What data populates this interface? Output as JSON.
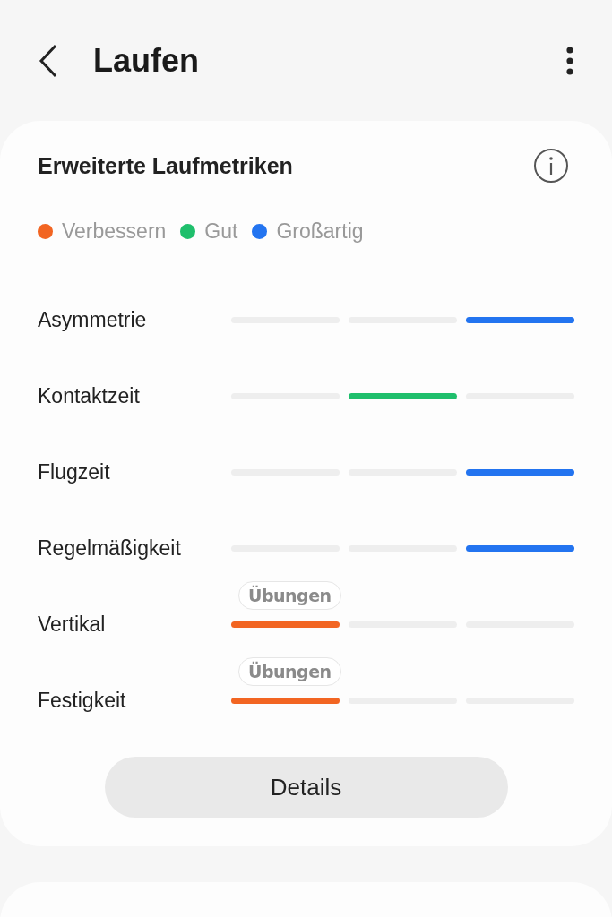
{
  "header": {
    "title": "Laufen"
  },
  "card": {
    "title": "Erweiterte Laufmetriken",
    "legend": [
      {
        "label": "Verbessern",
        "color": "#f26522"
      },
      {
        "label": "Gut",
        "color": "#1fbf6c"
      },
      {
        "label": "Großartig",
        "color": "#2374f0"
      }
    ],
    "metrics": [
      {
        "name": "Asymmetrie",
        "segments": [
          {
            "selected": false
          },
          {
            "selected": false
          },
          {
            "selected": true
          }
        ]
      },
      {
        "name": "Kontaktzeit",
        "segments": [
          {
            "selected": false
          },
          {
            "selected": true
          },
          {
            "selected": false
          }
        ]
      },
      {
        "name": "Flugzeit",
        "segments": [
          {
            "selected": false
          },
          {
            "selected": false
          },
          {
            "selected": true
          }
        ]
      },
      {
        "name": "Regelmäßigkeit",
        "segments": [
          {
            "selected": false
          },
          {
            "selected": false
          },
          {
            "selected": true
          }
        ]
      },
      {
        "name": "Vertikal",
        "segments": [
          {
            "selected": true
          },
          {
            "selected": false
          },
          {
            "selected": false
          }
        ],
        "badge": "Übungen"
      },
      {
        "name": "Festigkeit",
        "segments": [
          {
            "selected": true
          },
          {
            "selected": false
          },
          {
            "selected": false
          }
        ],
        "badge": "Übungen"
      }
    ],
    "button": "Details"
  }
}
